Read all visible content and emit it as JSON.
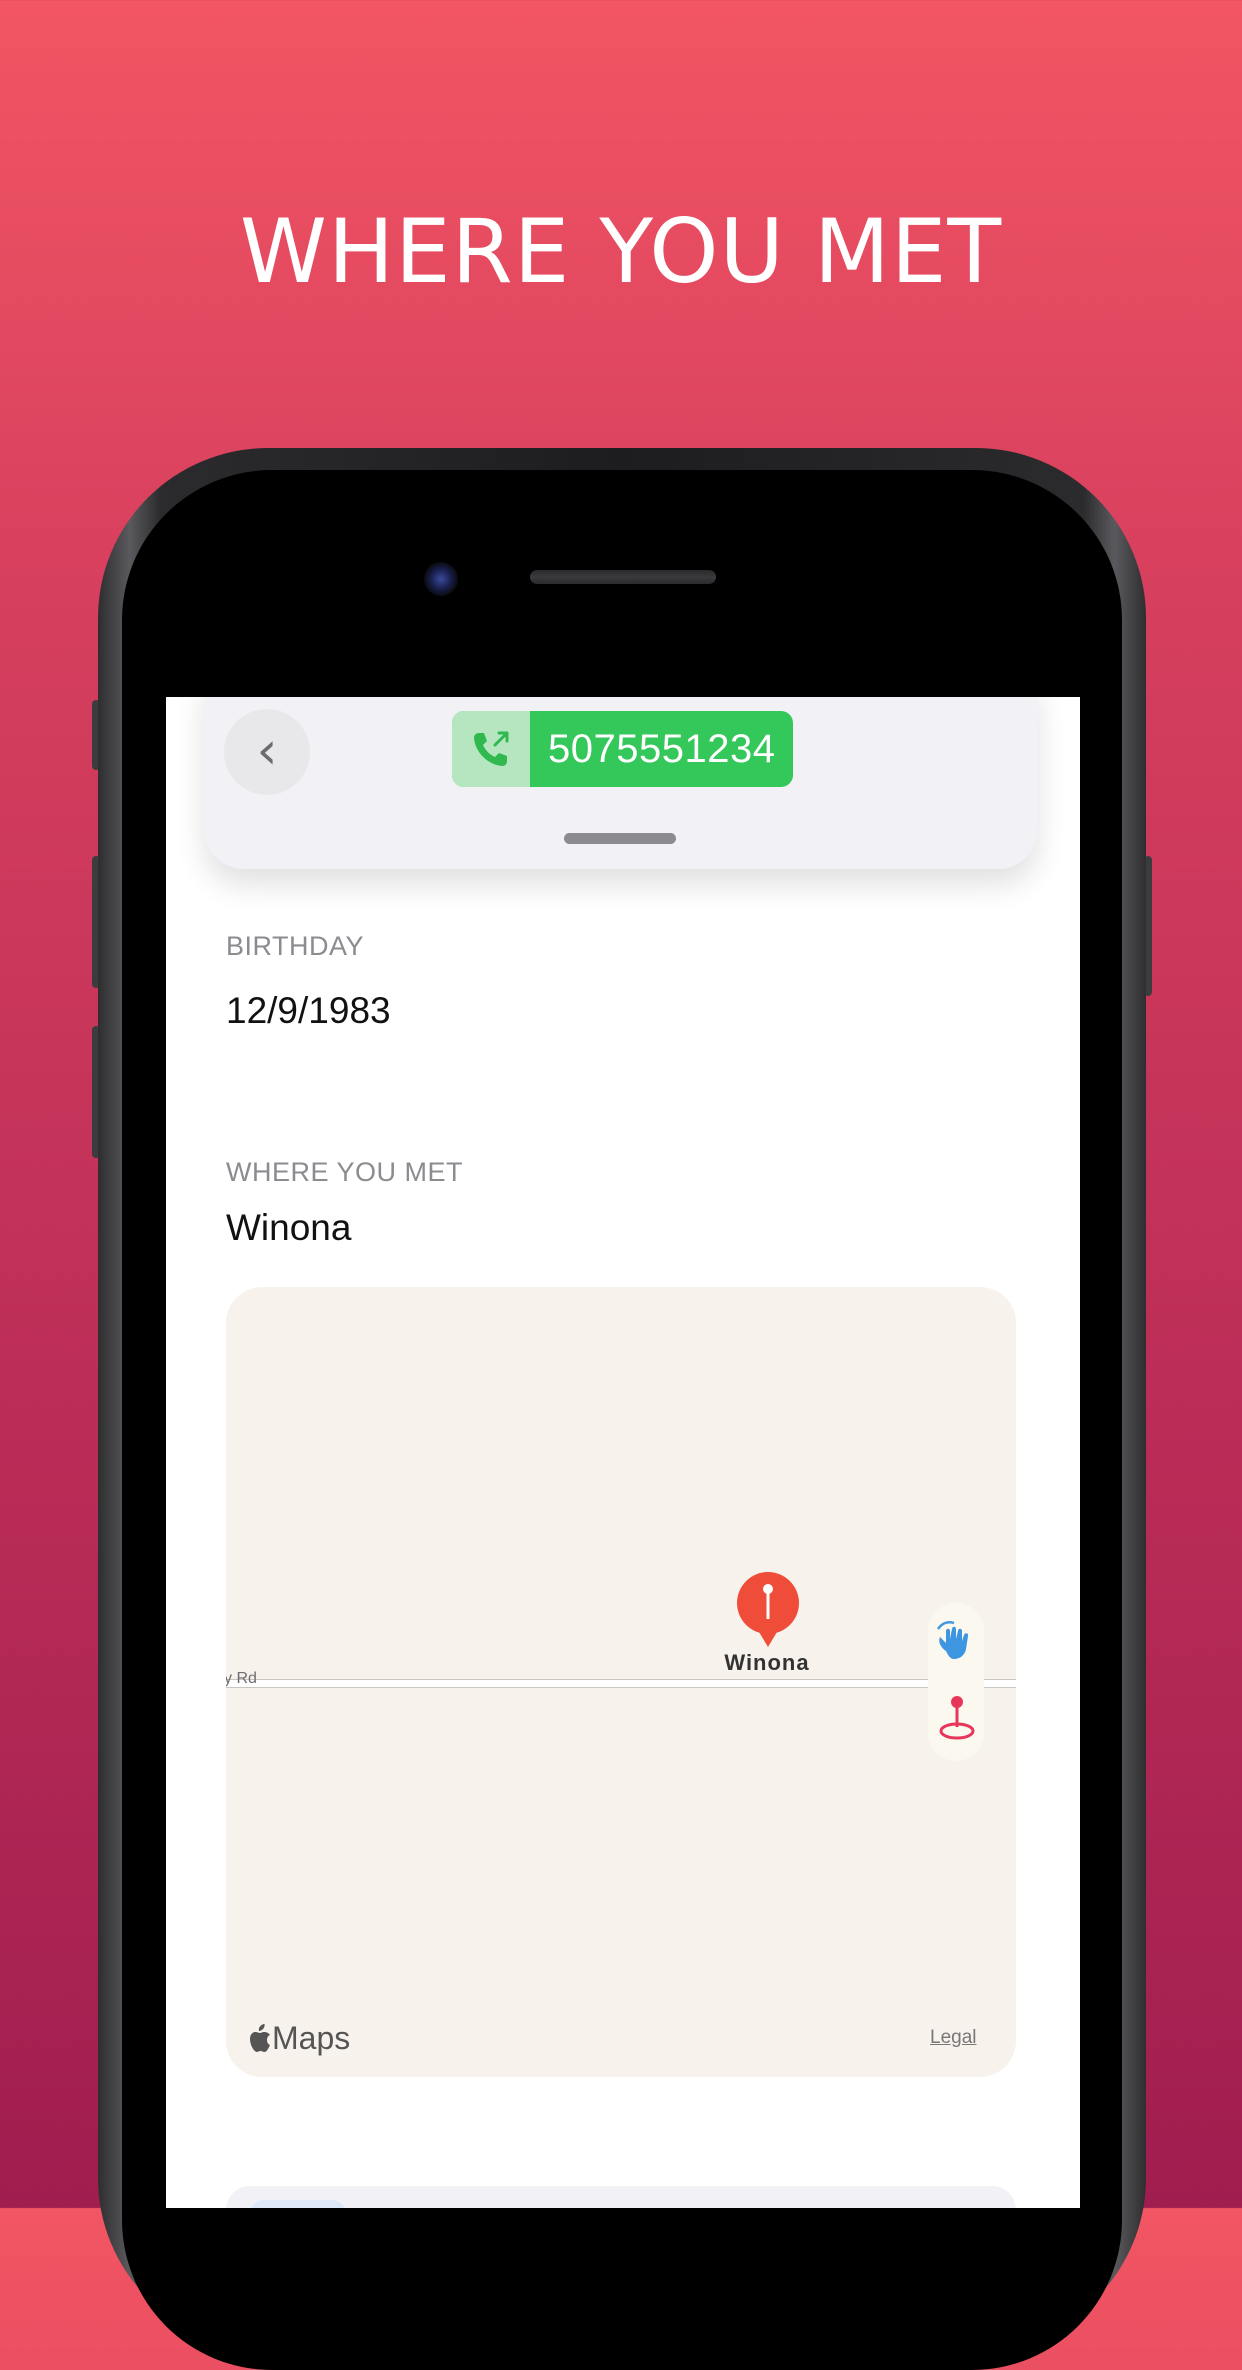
{
  "headline": "WHERE YOU MET",
  "contact": {
    "phone_number": "5075551234"
  },
  "birthday": {
    "label": "BIRTHDAY",
    "value": "12/9/1983"
  },
  "where_you_met": {
    "label": "WHERE YOU MET",
    "value": "Winona"
  },
  "map": {
    "pin_label": "Winona",
    "road_label": "y Rd",
    "brand": "Maps",
    "legal_label": "Legal",
    "pin_color": "#ef4d3a",
    "background_color": "#f7f3ec"
  },
  "colors": {
    "accent_green": "#34c759",
    "gradient_top": "#f25563",
    "gradient_bottom": "#a01d4f"
  }
}
